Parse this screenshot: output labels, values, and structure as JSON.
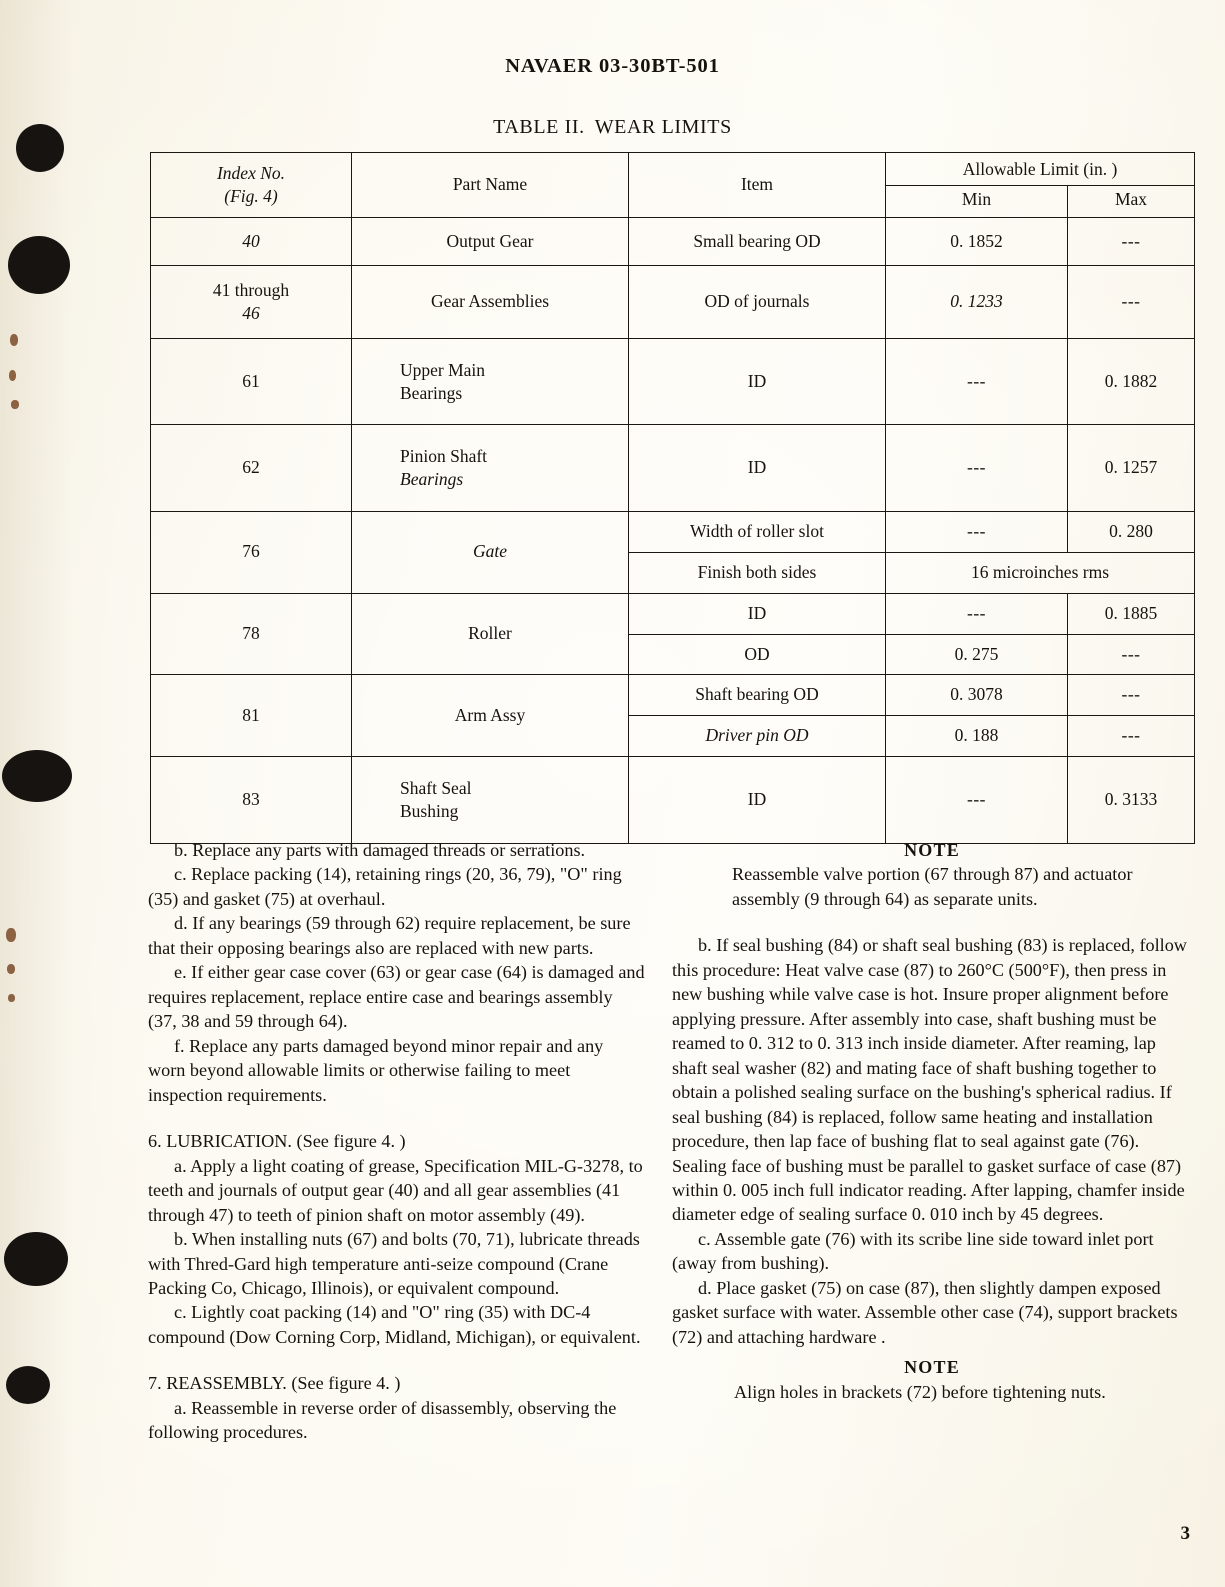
{
  "header": {
    "doc_number": "NAVAER 03-30BT-501",
    "table_title_prefix": "TABLE II.",
    "table_title_name": "WEAR LIMITS"
  },
  "table": {
    "columns": {
      "index_line1": "Index No.",
      "index_line2": "(Fig. 4)",
      "part_name": "Part Name",
      "item": "Item",
      "allowable": "Allowable Limit (in. )",
      "min": "Min",
      "max": "Max"
    },
    "rows": [
      {
        "index": "40",
        "part_name": "Output Gear",
        "lines": [
          {
            "item": "Small bearing OD",
            "min": "0. 1852",
            "max": "---"
          }
        ]
      },
      {
        "index_line1": "41 through",
        "index_line2": "46",
        "part_name": "Gear Assemblies",
        "lines": [
          {
            "item": "OD of journals",
            "min": "0. 1233",
            "max": "---"
          }
        ]
      },
      {
        "index": "61",
        "part_line1": "Upper Main",
        "part_line2": "Bearings",
        "lines": [
          {
            "item": "ID",
            "min": "---",
            "max": "0. 1882"
          }
        ]
      },
      {
        "index": "62",
        "part_line1": "Pinion Shaft",
        "part_line2": "Bearings",
        "lines": [
          {
            "item": "ID",
            "min": "---",
            "max": "0. 1257"
          }
        ]
      },
      {
        "index": "76",
        "part_name": "Gate",
        "lines": [
          {
            "item": "Width of roller slot",
            "min": "---",
            "max": "0. 280"
          },
          {
            "item": "Finish both sides",
            "span": "16 microinches rms"
          }
        ]
      },
      {
        "index": "78",
        "part_name": "Roller",
        "lines": [
          {
            "item": "ID",
            "min": "---",
            "max": "0. 1885"
          },
          {
            "item": "OD",
            "min": "0. 275",
            "max": "---"
          }
        ]
      },
      {
        "index": "81",
        "part_name": "Arm Assy",
        "lines": [
          {
            "item": "Shaft bearing OD",
            "min": "0. 3078",
            "max": "---"
          },
          {
            "item": "Driver pin OD",
            "min": "0. 188",
            "max": "---"
          }
        ]
      },
      {
        "index": "83",
        "part_line1": "Shaft Seal",
        "part_line2": "Bushing",
        "lines": [
          {
            "item": "ID",
            "min": "---",
            "max": "0. 3133"
          }
        ]
      }
    ]
  },
  "left_column": {
    "para_b": "b.   Replace any parts with damaged threads or serrations.",
    "para_c": "c.   Replace packing (14), retaining rings (20, 36, 79), \"O\" ring (35) and gasket (75) at overhaul.",
    "para_d": "d.   If any bearings (59 through 62) require replacement, be sure that their opposing bearings also are replaced with new parts.",
    "para_e": "e.   If either gear case cover (63) or gear case (64) is damaged and requires replacement, replace entire case and bearings assembly (37, 38 and 59 through 64).",
    "para_f": "f.   Replace any parts damaged beyond minor repair and any worn beyond allowable limits or otherwise failing to meet inspection requirements.",
    "section_6_head": "6.  LUBRICATION.  (See figure 4. )",
    "para_6a": "a.   Apply a light coating of grease, Specification MIL-G-3278, to teeth and journals of output gear (40) and all gear assemblies (41 through 47) to teeth of pinion shaft on motor assembly (49).",
    "para_6b": "b.   When installing nuts (67) and bolts (70, 71), lubricate threads with Thred-Gard high temperature anti-seize compound (Crane Packing Co, Chicago, Illinois), or equivalent compound.",
    "para_6c": "c.   Lightly coat packing (14) and \"O\" ring (35) with DC-4 compound (Dow Corning Corp, Midland, Michigan), or equivalent.",
    "section_7_head": "7.  REASSEMBLY.  (See figure 4. )",
    "para_7a": "a.   Reassemble in reverse order of disassembly, observing the following procedures."
  },
  "right_column": {
    "note_1_head": "NOTE",
    "note_1_body": "Reassemble valve portion (67 through 87) and actuator assembly (9 through 64) as separate units.",
    "para_b": "b.   If seal bushing (84) or shaft seal bushing (83) is replaced, follow this procedure:  Heat valve case (87) to 260°C (500°F), then press in new bushing while valve case is hot.  Insure proper alignment before applying pressure.   After assembly into case, shaft bushing must be reamed to 0. 312 to 0. 313 inch inside diameter. After reaming, lap shaft seal washer (82) and mating face of shaft bushing together to obtain a polished sealing surface on the bushing's spherical radius.  If seal bushing (84) is replaced, follow same heating and installation procedure, then lap face of bushing flat to seal against gate (76).  Sealing face of bushing must be parallel to gasket surface of case (87) within 0. 005 inch full indicator reading.  After lapping, chamfer inside diameter edge of sealing surface 0. 010 inch by 45 degrees.",
    "para_c": "c.   Assemble gate (76) with its scribe line side toward inlet port (away from bushing).",
    "para_d": "d.   Place gasket (75) on case (87), then slightly dampen exposed gasket surface with water.  Assemble other case (74), support brackets (72) and attaching hardware .",
    "note_2_head": "NOTE",
    "note_2_body": "Align holes in brackets (72) before tightening nuts."
  },
  "footer": {
    "page_number": "3"
  }
}
